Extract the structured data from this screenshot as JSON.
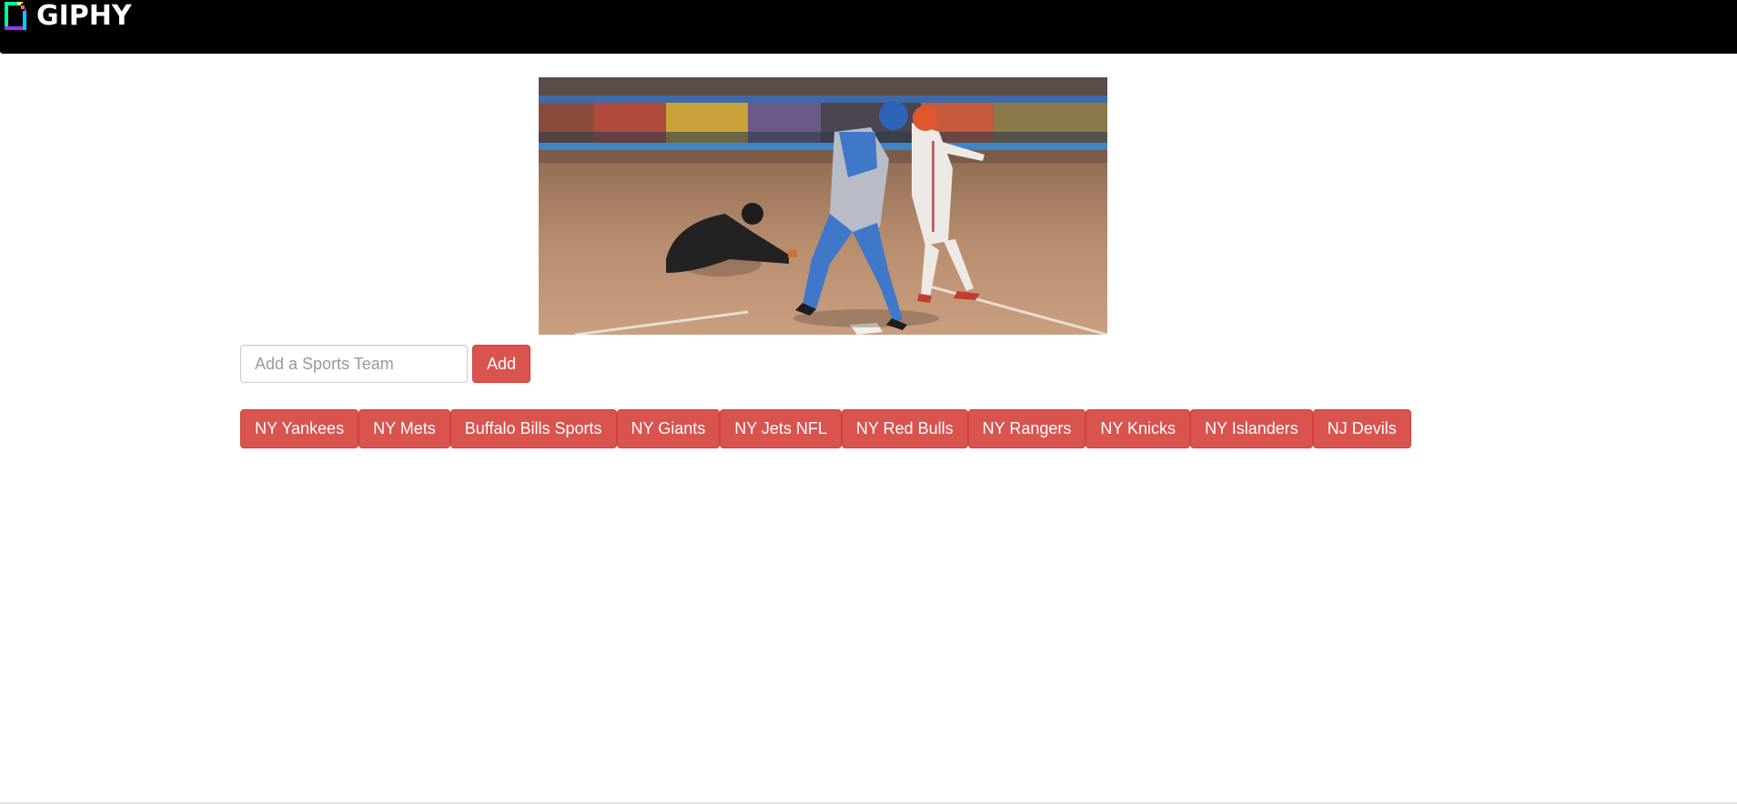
{
  "brand": {
    "name": "GIPHY",
    "icon": "giphy-logo-icon",
    "colors": {
      "green": "#00ff99",
      "blue": "#00ccff",
      "purple": "#9933ff",
      "pink": "#ff6666",
      "yellow": "#fff35c"
    }
  },
  "gif": {
    "icon": "baseball-gif-image"
  },
  "search": {
    "placeholder": "Add a Sports Team",
    "value": ""
  },
  "add_button": {
    "label": "Add"
  },
  "teams": [
    "NY Yankees",
    "NY Mets",
    "Buffalo Bills Sports",
    "NY Giants",
    "NY Jets NFL",
    "NY Red Bulls",
    "NY Rangers",
    "NY Knicks",
    "NY Islanders",
    "NJ Devils"
  ],
  "colors": {
    "topbar": "#000000",
    "button": "#d9534f",
    "button_border": "#d43f3a",
    "button_text": "#ffffff"
  }
}
